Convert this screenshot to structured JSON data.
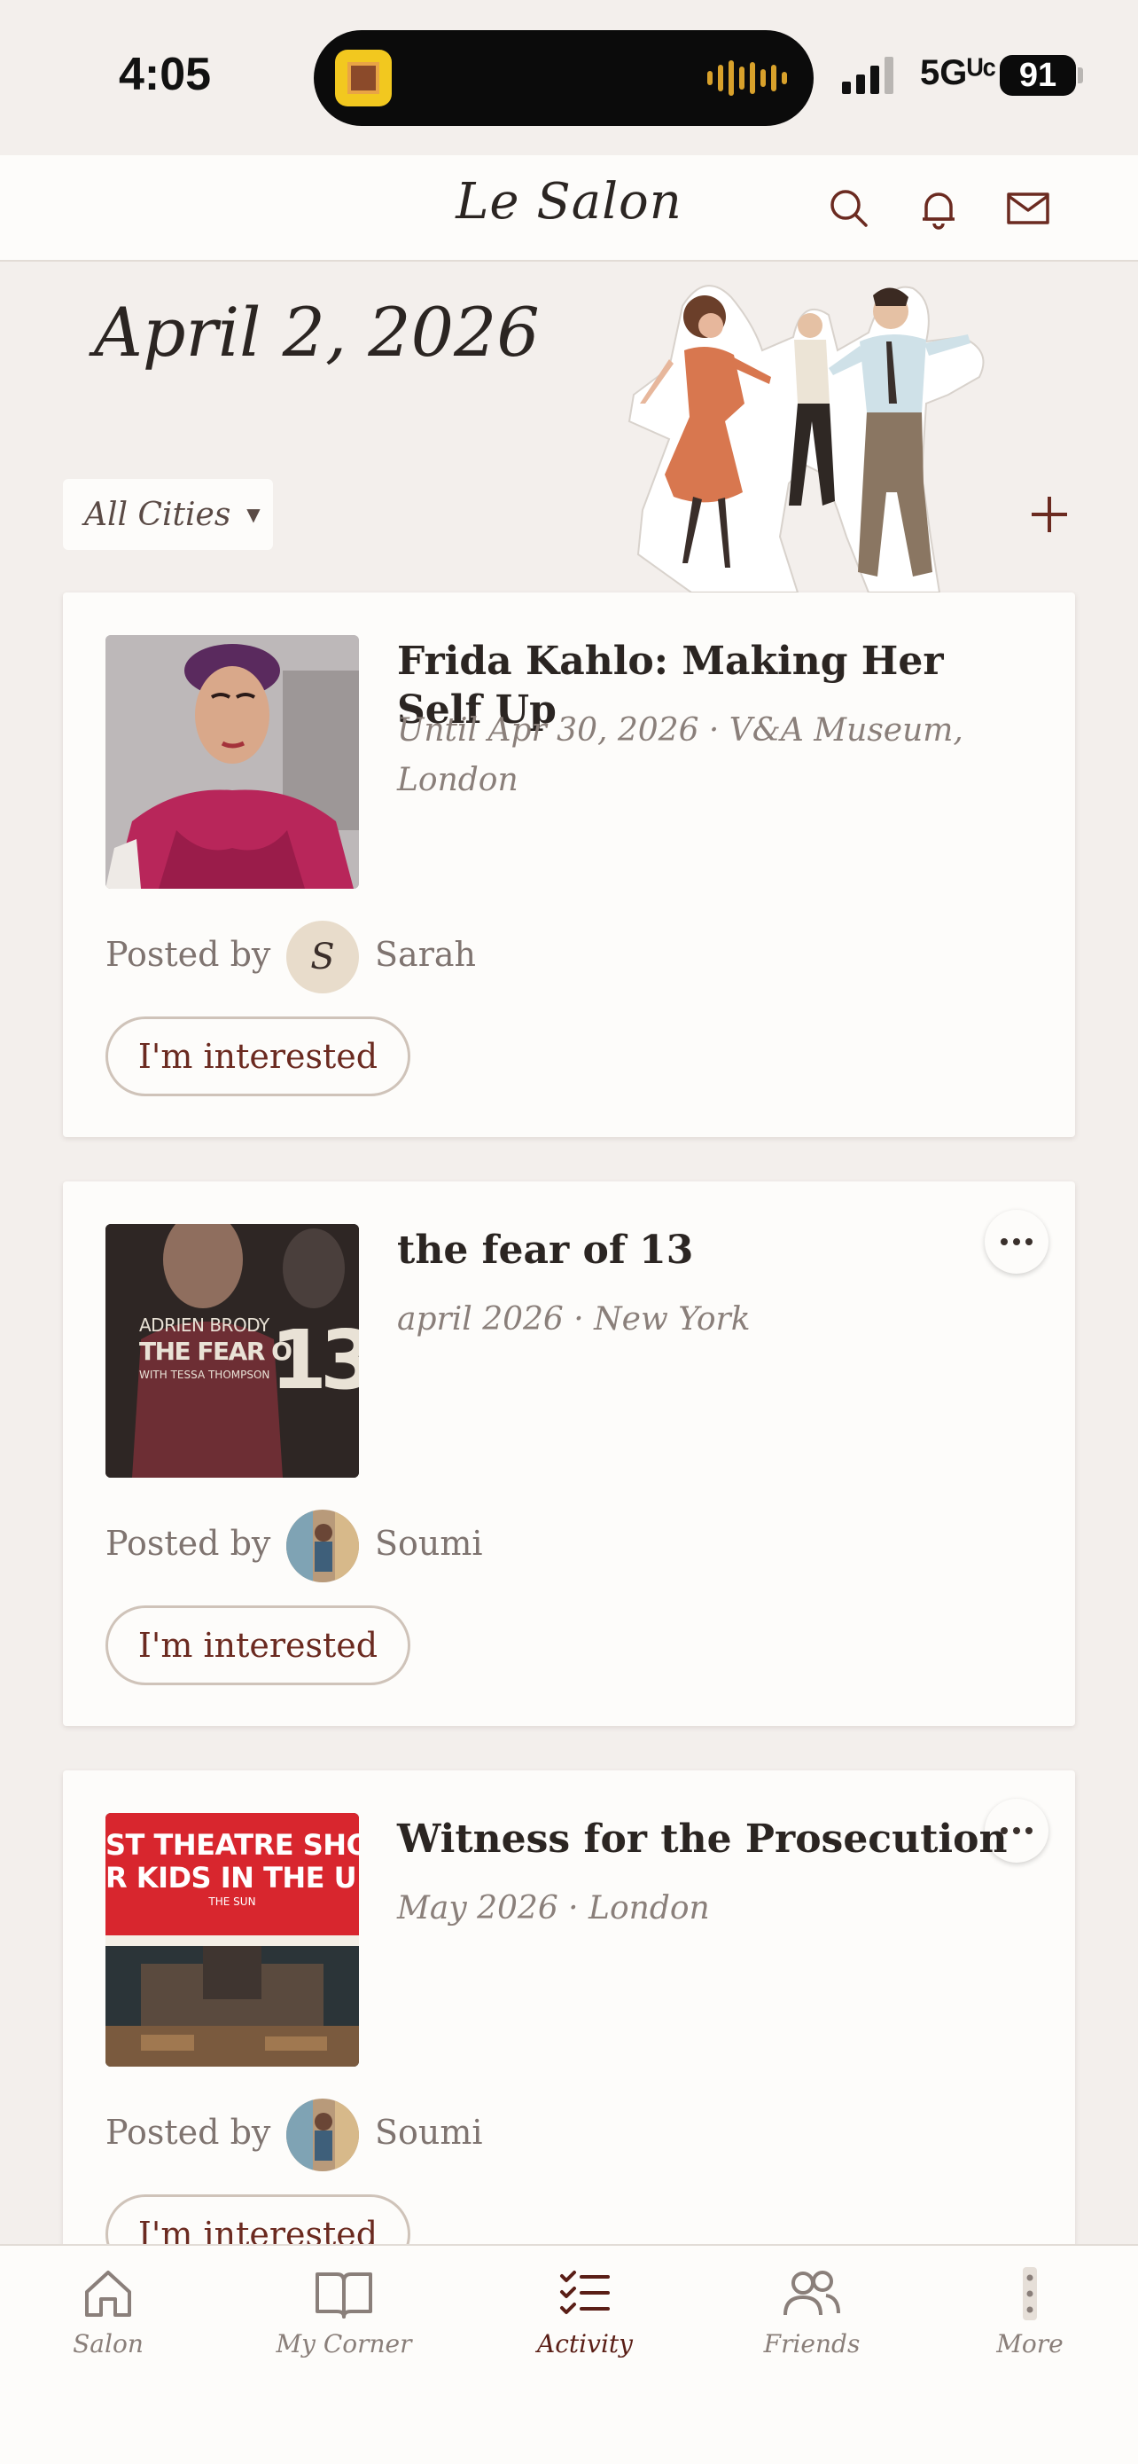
{
  "status_bar": {
    "time": "4:05",
    "network": "5Gᵁᶜ",
    "battery": "91"
  },
  "header": {
    "title": "Le Salon"
  },
  "date_title": "April 2, 2026",
  "city_filter": {
    "label": "All Cities"
  },
  "events": [
    {
      "title": "Frida Kahlo: Making Her Self Up",
      "meta": "Until Apr 30, 2026 · V&A Museum, London",
      "posted_by_label": "Posted by",
      "poster": "Sarah",
      "avatar_initial": "S",
      "interest_label": "I'm interested"
    },
    {
      "title": "the fear of 13",
      "meta": "april 2026 · New York",
      "posted_by_label": "Posted by",
      "poster": "Soumi",
      "interest_label": "I'm interested",
      "poster_text": {
        "line1": "ADRIEN BRODY",
        "line2": "THE FEAR OF",
        "number": "13",
        "line3": "WITH TESSA THOMPSON"
      }
    },
    {
      "title": "Witness for the Prosecution",
      "meta": "May 2026 · London",
      "posted_by_label": "Posted by",
      "poster": "Soumi",
      "interest_label": "I'm interested",
      "poster_text": {
        "line1": "ST THEATRE SHO",
        "line2": "R KIDS IN THE U",
        "line3": "THE SUN"
      }
    }
  ],
  "tabs": [
    {
      "label": "Salon",
      "icon": "home-icon"
    },
    {
      "label": "My Corner",
      "icon": "book-icon"
    },
    {
      "label": "Activity",
      "icon": "checklist-icon",
      "active": true
    },
    {
      "label": "Friends",
      "icon": "friends-icon"
    },
    {
      "label": "More",
      "icon": "more-vertical-icon"
    }
  ],
  "colors": {
    "accent": "#5a1e16",
    "background": "#f3efec",
    "card": "#fdfcfa"
  }
}
